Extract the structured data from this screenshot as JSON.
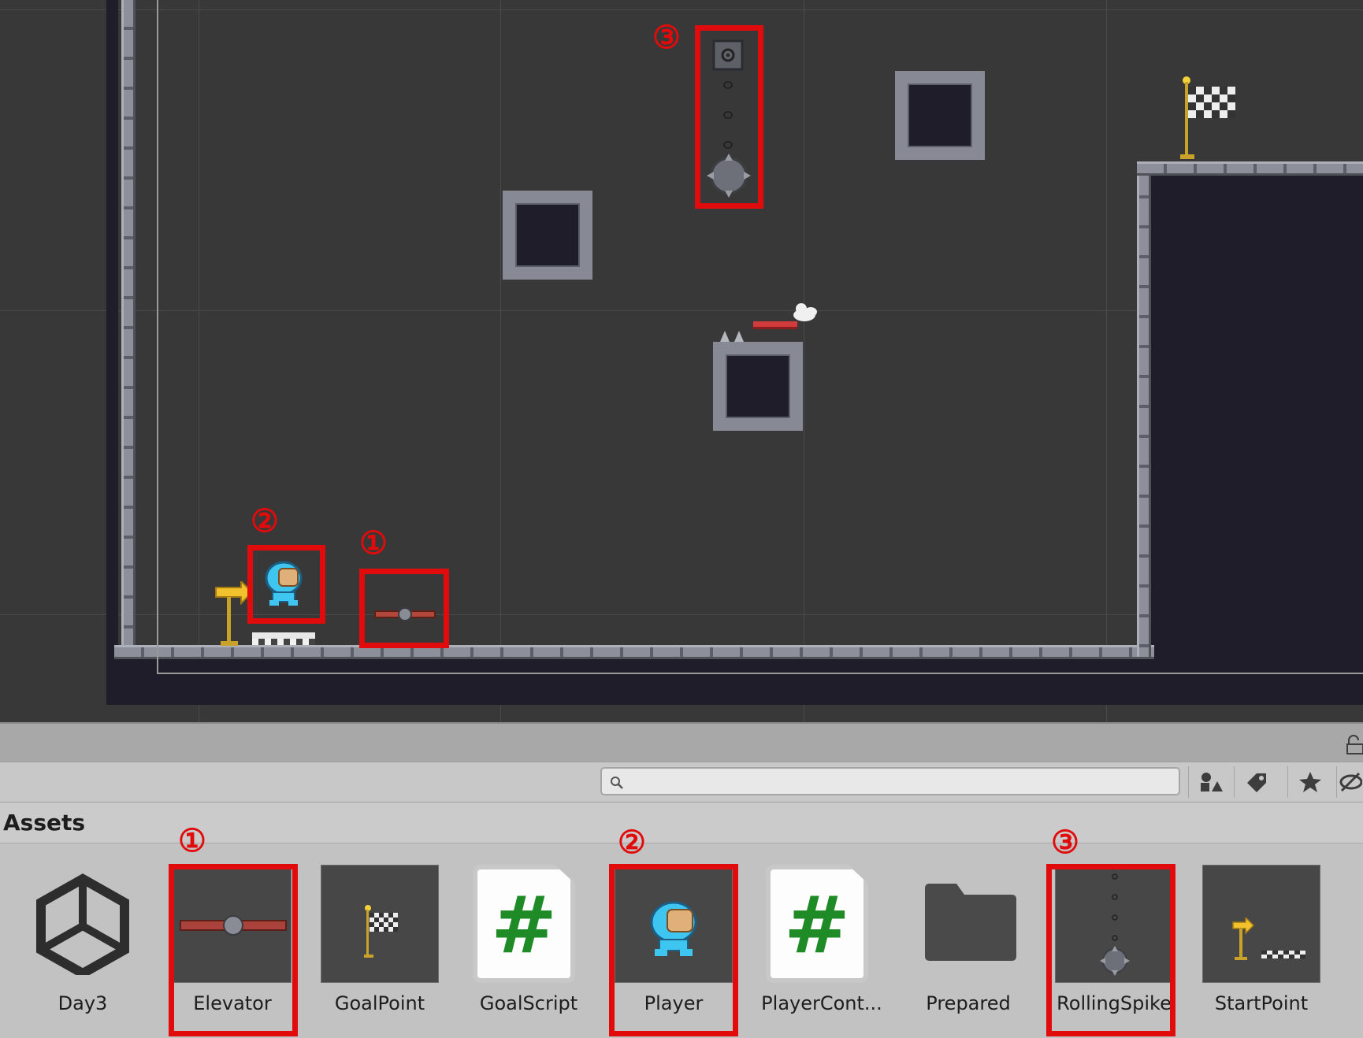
{
  "markers": {
    "one": "①",
    "two": "②",
    "three": "③"
  },
  "project": {
    "breadcrumb": "Assets",
    "search": {
      "placeholder": "",
      "value": ""
    }
  },
  "assets": [
    {
      "name": "Day3",
      "icon": "unity-logo-icon",
      "highlighted": false
    },
    {
      "name": "Elevator",
      "icon": "elevator-platform-icon",
      "highlighted": true,
      "marker": "①"
    },
    {
      "name": "GoalPoint",
      "icon": "goal-flag-icon",
      "highlighted": false
    },
    {
      "name": "GoalScript",
      "icon": "csharp-script-icon",
      "highlighted": false
    },
    {
      "name": "Player",
      "icon": "player-character-icon",
      "highlighted": true,
      "marker": "②"
    },
    {
      "name": "PlayerCont...",
      "icon": "csharp-script-icon",
      "highlighted": false
    },
    {
      "name": "Prepared",
      "icon": "folder-icon",
      "highlighted": false
    },
    {
      "name": "RollingSpike",
      "icon": "rolling-spike-icon",
      "highlighted": true,
      "marker": "③"
    },
    {
      "name": "StartPoint",
      "icon": "start-point-icon",
      "highlighted": false
    }
  ],
  "colors": {
    "highlight": "#e20b0b",
    "script_hash": "#1e8b26",
    "scene_bg": "#383838"
  }
}
